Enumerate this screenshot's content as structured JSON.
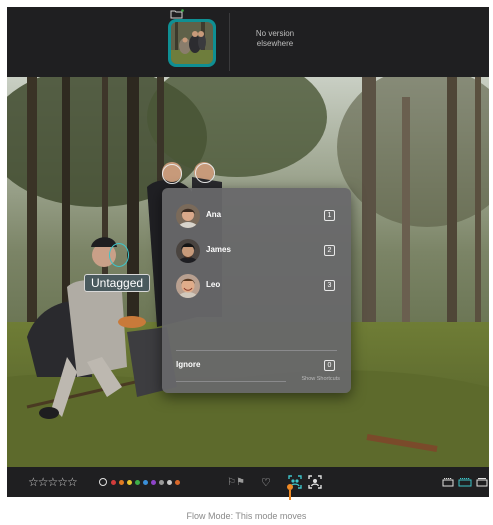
{
  "filmstrip": {
    "no_version_text": "No version elsewhere"
  },
  "photo": {
    "untagged_label": "Untagged"
  },
  "people_popover": {
    "people": [
      {
        "name": "Ana",
        "shortcut": "1"
      },
      {
        "name": "James",
        "shortcut": "2"
      },
      {
        "name": "Leo",
        "shortcut": "3"
      }
    ],
    "ignore_label": "Ignore",
    "ignore_shortcut": "0",
    "show_shortcuts_label": "Show Shortcuts"
  },
  "toolbar": {
    "stars": "☆☆☆☆☆",
    "color_labels": [
      "#d23c3c",
      "#e07b22",
      "#e6c531",
      "#3fae49",
      "#3a8fd9",
      "#8e44c9",
      "#9a9a9a",
      "#c9c9c9",
      "#d9682a"
    ],
    "flags": "⚐⚑",
    "heart": "♡"
  },
  "accent_color": "#3ec4c9",
  "flow_indicator_color": "#f08a24",
  "caption": "Flow Mode: This mode moves"
}
